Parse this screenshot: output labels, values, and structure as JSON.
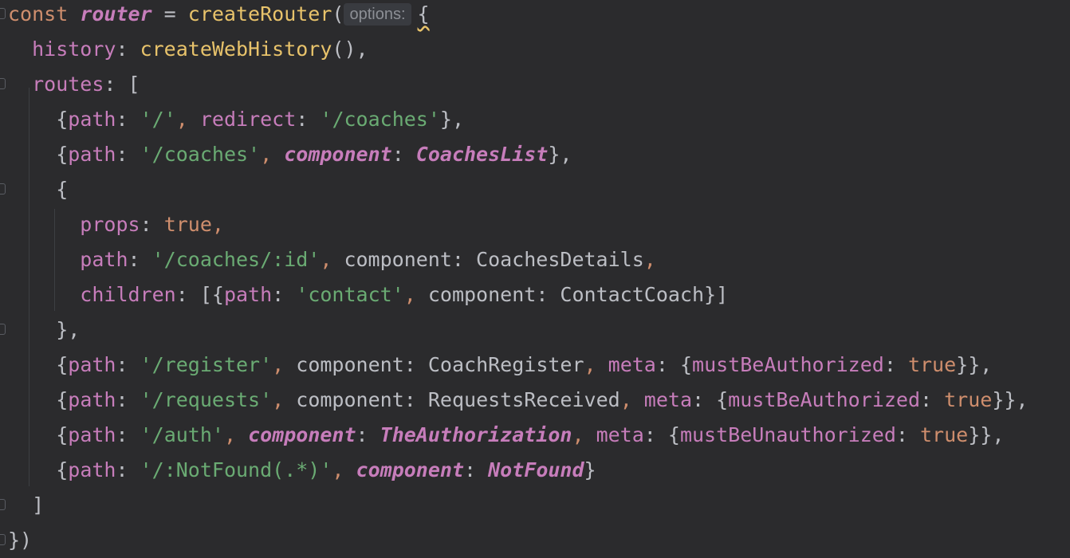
{
  "lines": [
    [
      {
        "t": "const ",
        "c": "kw"
      },
      {
        "t": "router",
        "c": "ital-var"
      },
      {
        "t": " = ",
        "c": "plain"
      },
      {
        "t": "createRouter",
        "c": "fn2"
      },
      {
        "t": "(",
        "c": "punct"
      },
      {
        "hint": "options:"
      },
      {
        "t": "{",
        "c": "punct",
        "squiggle": true
      }
    ],
    [
      {
        "t": "  history",
        "c": "prop"
      },
      {
        "t": ": ",
        "c": "punct"
      },
      {
        "t": "createWebHistory",
        "c": "fn2"
      },
      {
        "t": "(),",
        "c": "punct"
      }
    ],
    [
      {
        "t": "  routes",
        "c": "prop"
      },
      {
        "t": ": [",
        "c": "punct"
      }
    ],
    [
      {
        "t": "    {",
        "c": "punct"
      },
      {
        "t": "path",
        "c": "prop"
      },
      {
        "t": ": ",
        "c": "punct"
      },
      {
        "t": "'/'",
        "c": "str"
      },
      {
        "t": ", ",
        "c": "kw"
      },
      {
        "t": "redirect",
        "c": "prop"
      },
      {
        "t": ": ",
        "c": "punct"
      },
      {
        "t": "'/coaches'",
        "c": "str"
      },
      {
        "t": "},",
        "c": "punct"
      }
    ],
    [
      {
        "t": "    {",
        "c": "punct"
      },
      {
        "t": "path",
        "c": "prop"
      },
      {
        "t": ": ",
        "c": "punct"
      },
      {
        "t": "'/coaches'",
        "c": "str"
      },
      {
        "t": ", ",
        "c": "kw"
      },
      {
        "t": "component",
        "c": "ital-prop"
      },
      {
        "t": ": ",
        "c": "punct"
      },
      {
        "t": "CoachesList",
        "c": "ital-comp"
      },
      {
        "t": "},",
        "c": "punct"
      }
    ],
    [
      {
        "t": "    {",
        "c": "punct"
      }
    ],
    [
      {
        "t": "      props",
        "c": "prop"
      },
      {
        "t": ": ",
        "c": "punct"
      },
      {
        "t": "true",
        "c": "bool"
      },
      {
        "t": ",",
        "c": "kw"
      }
    ],
    [
      {
        "t": "      path",
        "c": "prop"
      },
      {
        "t": ": ",
        "c": "punct"
      },
      {
        "t": "'/coaches/:id'",
        "c": "str"
      },
      {
        "t": ", ",
        "c": "kw"
      },
      {
        "t": "component",
        "c": "plain"
      },
      {
        "t": ": ",
        "c": "punct"
      },
      {
        "t": "CoachesDetails",
        "c": "plain"
      },
      {
        "t": ",",
        "c": "kw"
      }
    ],
    [
      {
        "t": "      children",
        "c": "prop"
      },
      {
        "t": ": [{",
        "c": "punct"
      },
      {
        "t": "path",
        "c": "prop"
      },
      {
        "t": ": ",
        "c": "punct"
      },
      {
        "t": "'contact'",
        "c": "str"
      },
      {
        "t": ", ",
        "c": "kw"
      },
      {
        "t": "component",
        "c": "plain"
      },
      {
        "t": ": ",
        "c": "punct"
      },
      {
        "t": "ContactCoach",
        "c": "plain"
      },
      {
        "t": "}]",
        "c": "punct"
      }
    ],
    [
      {
        "t": "    },",
        "c": "punct"
      }
    ],
    [
      {
        "t": "    {",
        "c": "punct"
      },
      {
        "t": "path",
        "c": "prop"
      },
      {
        "t": ": ",
        "c": "punct"
      },
      {
        "t": "'/register'",
        "c": "str"
      },
      {
        "t": ", ",
        "c": "kw"
      },
      {
        "t": "component",
        "c": "plain"
      },
      {
        "t": ": ",
        "c": "punct"
      },
      {
        "t": "CoachRegister",
        "c": "plain"
      },
      {
        "t": ", ",
        "c": "kw"
      },
      {
        "t": "meta",
        "c": "prop"
      },
      {
        "t": ": {",
        "c": "punct"
      },
      {
        "t": "mustBeAuthorized",
        "c": "prop"
      },
      {
        "t": ": ",
        "c": "punct"
      },
      {
        "t": "true",
        "c": "bool"
      },
      {
        "t": "}},",
        "c": "punct"
      }
    ],
    [
      {
        "t": "    {",
        "c": "punct"
      },
      {
        "t": "path",
        "c": "prop"
      },
      {
        "t": ": ",
        "c": "punct"
      },
      {
        "t": "'/requests'",
        "c": "str"
      },
      {
        "t": ", ",
        "c": "kw"
      },
      {
        "t": "component",
        "c": "plain"
      },
      {
        "t": ": ",
        "c": "punct"
      },
      {
        "t": "RequestsReceived",
        "c": "plain"
      },
      {
        "t": ", ",
        "c": "kw"
      },
      {
        "t": "meta",
        "c": "prop"
      },
      {
        "t": ": {",
        "c": "punct"
      },
      {
        "t": "mustBeAuthorized",
        "c": "prop"
      },
      {
        "t": ": ",
        "c": "punct"
      },
      {
        "t": "true",
        "c": "bool"
      },
      {
        "t": "}},",
        "c": "punct"
      }
    ],
    [
      {
        "t": "    {",
        "c": "punct"
      },
      {
        "t": "path",
        "c": "prop"
      },
      {
        "t": ": ",
        "c": "punct"
      },
      {
        "t": "'/auth'",
        "c": "str"
      },
      {
        "t": ", ",
        "c": "kw"
      },
      {
        "t": "component",
        "c": "ital-prop"
      },
      {
        "t": ": ",
        "c": "punct"
      },
      {
        "t": "TheAuthorization",
        "c": "ital-comp"
      },
      {
        "t": ", ",
        "c": "kw"
      },
      {
        "t": "meta",
        "c": "prop"
      },
      {
        "t": ": {",
        "c": "punct"
      },
      {
        "t": "mustBeUnauthorized",
        "c": "prop"
      },
      {
        "t": ": ",
        "c": "punct"
      },
      {
        "t": "true",
        "c": "bool"
      },
      {
        "t": "}},",
        "c": "punct"
      }
    ],
    [
      {
        "t": "    {",
        "c": "punct"
      },
      {
        "t": "path",
        "c": "prop"
      },
      {
        "t": ": ",
        "c": "punct"
      },
      {
        "t": "'/:NotFound(.*)'",
        "c": "str"
      },
      {
        "t": ", ",
        "c": "kw"
      },
      {
        "t": "component",
        "c": "ital-prop"
      },
      {
        "t": ": ",
        "c": "punct"
      },
      {
        "t": "NotFound",
        "c": "ital-comp"
      },
      {
        "t": "}",
        "c": "punct"
      }
    ],
    [
      {
        "t": "  ]",
        "c": "punct"
      }
    ],
    [
      {
        "t": "})",
        "c": "punct"
      }
    ]
  ]
}
